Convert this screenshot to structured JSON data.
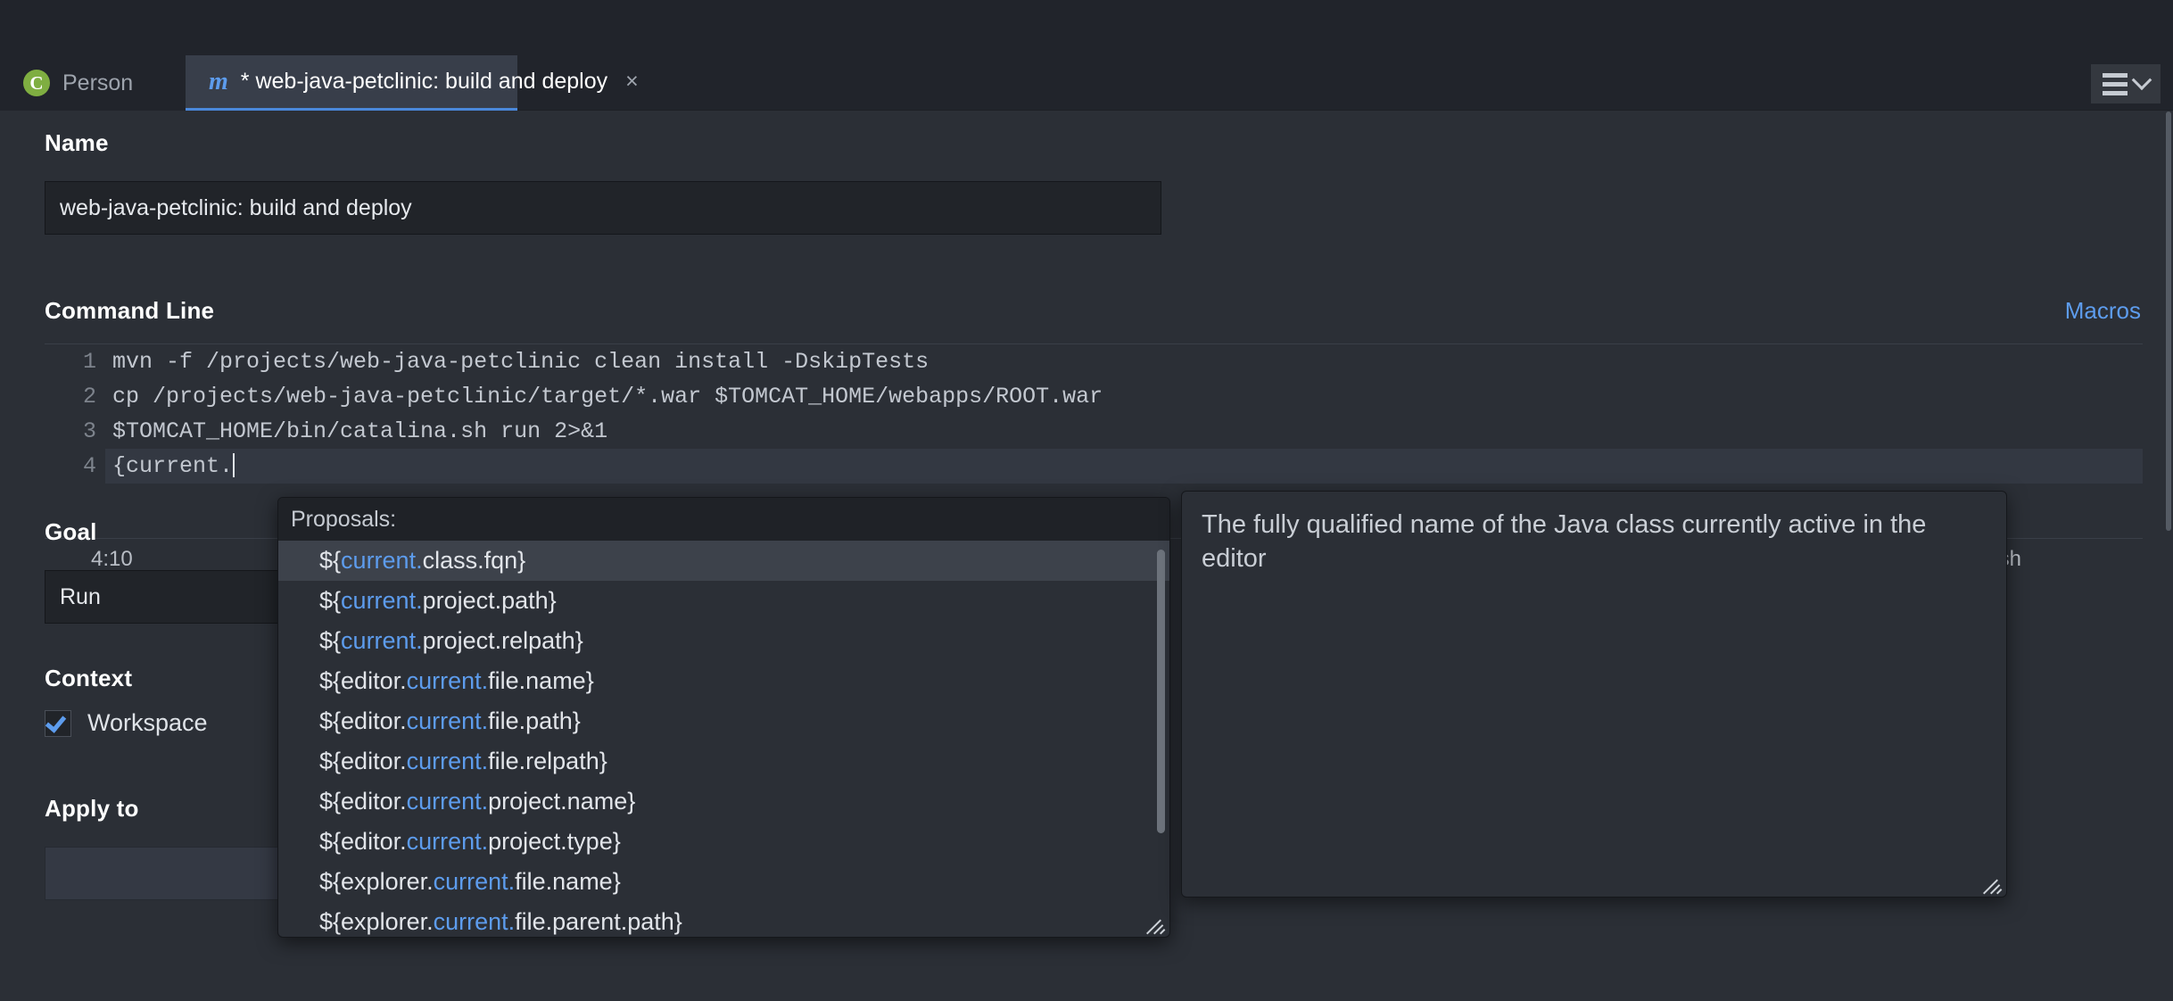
{
  "window": {
    "menu_icon": "hamburger-menu-icon",
    "menu_chevron": "chevron-down-icon"
  },
  "tabs": [
    {
      "label": "Person",
      "icon": "java-class-icon",
      "active": false,
      "modified": false
    },
    {
      "label": "* web-java-petclinic: build and deploy",
      "icon": "maven-m-icon",
      "active": true,
      "modified": true,
      "close": "×"
    }
  ],
  "form": {
    "name_label": "Name",
    "name_value": "web-java-petclinic: build and deploy",
    "command_line_label": "Command Line",
    "macros_link": "Macros",
    "goal_label": "Goal",
    "goal_value": "Run",
    "context_label": "Context",
    "context_workspace_label": "Workspace",
    "apply_to_label": "Apply to"
  },
  "editor": {
    "lines": [
      {
        "num": "1",
        "text": "mvn -f /projects/web-java-petclinic clean install -DskipTests"
      },
      {
        "num": "2",
        "text": "cp /projects/web-java-petclinic/target/*.war $TOMCAT_HOME/webapps/ROOT.war"
      },
      {
        "num": "3",
        "text": "$TOMCAT_HOME/bin/catalina.sh run 2>&1"
      },
      {
        "num": "4",
        "text": "{current."
      }
    ],
    "cursor_position": "4:10",
    "mime_type": "ext/x-sh"
  },
  "proposals": {
    "header": "Proposals:",
    "items": [
      {
        "prefix": "${",
        "match": "current.",
        "suffix": "class.fqn}",
        "selected": true
      },
      {
        "prefix": "${",
        "match": "current.",
        "suffix": "project.path}",
        "selected": false
      },
      {
        "prefix": "${",
        "match": "current.",
        "suffix": "project.relpath}",
        "selected": false
      },
      {
        "prefix": "${editor.",
        "match": "current.",
        "suffix": "file.name}",
        "selected": false
      },
      {
        "prefix": "${editor.",
        "match": "current.",
        "suffix": "file.path}",
        "selected": false
      },
      {
        "prefix": "${editor.",
        "match": "current.",
        "suffix": "file.relpath}",
        "selected": false
      },
      {
        "prefix": "${editor.",
        "match": "current.",
        "suffix": "project.name}",
        "selected": false
      },
      {
        "prefix": "${editor.",
        "match": "current.",
        "suffix": "project.type}",
        "selected": false
      },
      {
        "prefix": "${explorer.",
        "match": "current.",
        "suffix": "file.name}",
        "selected": false
      },
      {
        "prefix": "${explorer.",
        "match": "current.",
        "suffix": "file.parent.path}",
        "selected": false
      }
    ]
  },
  "documentation": {
    "text": "The fully qualified name of the Java class currently active in the editor"
  },
  "colors": {
    "accent": "#5d9ced",
    "tab_active_bg": "#383e4a",
    "background": "#2b2f36",
    "input_bg": "#212429",
    "class_icon_green": "#7fae41"
  }
}
